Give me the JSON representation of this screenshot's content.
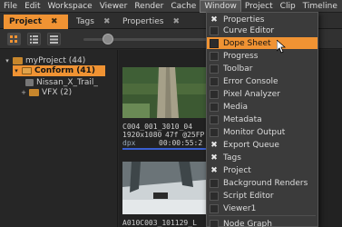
{
  "menubar": {
    "items": [
      "File",
      "Edit",
      "Workspace",
      "Viewer",
      "Render",
      "Cache",
      "Window",
      "Project",
      "Clip",
      "Timeline"
    ]
  },
  "tabs": [
    {
      "label": "Project",
      "close": "✖"
    },
    {
      "label": "Tags",
      "close": "✖"
    },
    {
      "label": "Properties",
      "close": "✖"
    }
  ],
  "tree": {
    "root": {
      "label": "myProject (44)"
    },
    "conform": {
      "label": "Conform (41)"
    },
    "item": {
      "label": "Nissan_X_Trail_"
    },
    "vfx": {
      "label": "VFX (2)"
    }
  },
  "clips": [
    {
      "name": "C004_001_3010_04",
      "res": "1920x1080",
      "fps": "47f @25FP",
      "dur": "00:00:55:2",
      "fmt": "dpx"
    },
    {
      "name": "A010C003_101129_L",
      "res": "",
      "fps": "",
      "dur": "",
      "fmt": ""
    }
  ],
  "window_menu": {
    "items": [
      {
        "label": "Properties",
        "checked": true
      },
      {
        "label": "Curve Editor",
        "checked": false
      },
      {
        "label": "Dope Sheet",
        "checked": false
      },
      {
        "label": "Progress",
        "checked": false
      },
      {
        "label": "Toolbar",
        "checked": false
      },
      {
        "label": "Error Console",
        "checked": false
      },
      {
        "label": "Pixel Analyzer",
        "checked": false
      },
      {
        "label": "Media",
        "checked": false
      },
      {
        "label": "Metadata",
        "checked": false
      },
      {
        "label": "Monitor Output",
        "checked": false
      },
      {
        "label": "Export Queue",
        "checked": true
      },
      {
        "label": "Tags",
        "checked": true
      },
      {
        "label": "Project",
        "checked": true
      },
      {
        "label": "Background Renders",
        "checked": false
      },
      {
        "label": "Script Editor",
        "checked": false
      },
      {
        "label": "Viewer1",
        "checked": false
      },
      {
        "label": "Node Graph",
        "checked": false
      }
    ],
    "highlighted": "Dope Sheet"
  },
  "colors": {
    "accent": "#f09333",
    "menu_bg": "#3b3b3b",
    "panel_bg": "#262626"
  }
}
